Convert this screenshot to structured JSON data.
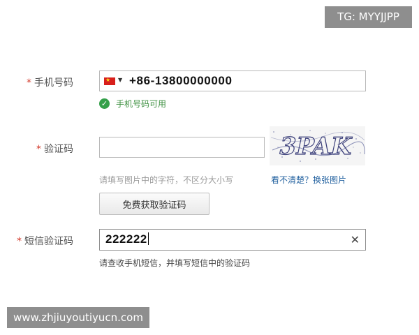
{
  "watermarks": {
    "tag": "TG: MYYJJPP",
    "site": "www.zhjiuyoutiyucn.com"
  },
  "form": {
    "required_mark": "*",
    "phone": {
      "label": "手机号码",
      "country_flag_icon": "china-flag-icon",
      "value": "+86-13800000000",
      "status_icon": "check-circle-icon",
      "status_text": "手机号码可用",
      "status_color": "#35a04a"
    },
    "captcha": {
      "label": "验证码",
      "value": "",
      "image_text": "3PAK",
      "hint": "请填写图片中的字符，不区分大小写",
      "refresh_link": "看不清楚？换张图片"
    },
    "get_code_button": "免费获取验证码",
    "sms": {
      "label": "短信验证码",
      "value": "222222",
      "clear_icon": "close-icon",
      "hint": "请查收手机短信，并填写短信中的验证码"
    }
  }
}
